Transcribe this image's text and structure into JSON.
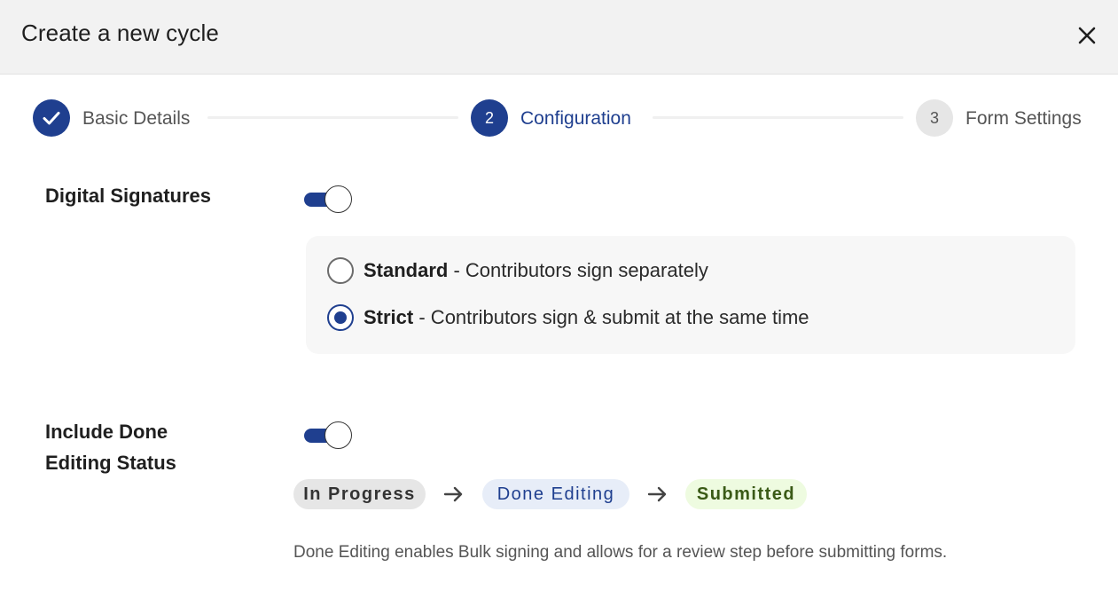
{
  "dialog": {
    "title": "Create a new cycle",
    "close_icon": "close-icon"
  },
  "stepper": {
    "steps": [
      {
        "number": "1",
        "label": "Basic Details",
        "state": "completed",
        "icon": "checkmark-icon"
      },
      {
        "number": "2",
        "label": "Configuration",
        "state": "active"
      },
      {
        "number": "3",
        "label": "Form Settings",
        "state": "pending"
      }
    ]
  },
  "digital_signatures": {
    "label": "Digital Signatures",
    "enabled": true,
    "options": [
      {
        "title": "Standard",
        "description": " - Contributors sign separately",
        "selected": false
      },
      {
        "title": "Strict",
        "description": " - Contributors sign & submit at the same time",
        "selected": true
      }
    ]
  },
  "done_editing": {
    "label_line1": "Include Done",
    "label_line2": "Editing Status",
    "enabled": true,
    "statuses": [
      "In Progress",
      "Done Editing",
      "Submitted"
    ],
    "arrow_icon": "arrow-right-icon",
    "help_text": "Done Editing enables Bulk signing and allows for a review step before submitting forms."
  },
  "colors": {
    "accent": "#1f3f8f",
    "header_bg": "#f2f2f2",
    "panel_bg": "#f7f7f7",
    "chip_in_progress_bg": "#e6e6e6",
    "chip_done_editing_bg": "#e7edf8",
    "chip_submitted_bg": "#eefbe0"
  }
}
